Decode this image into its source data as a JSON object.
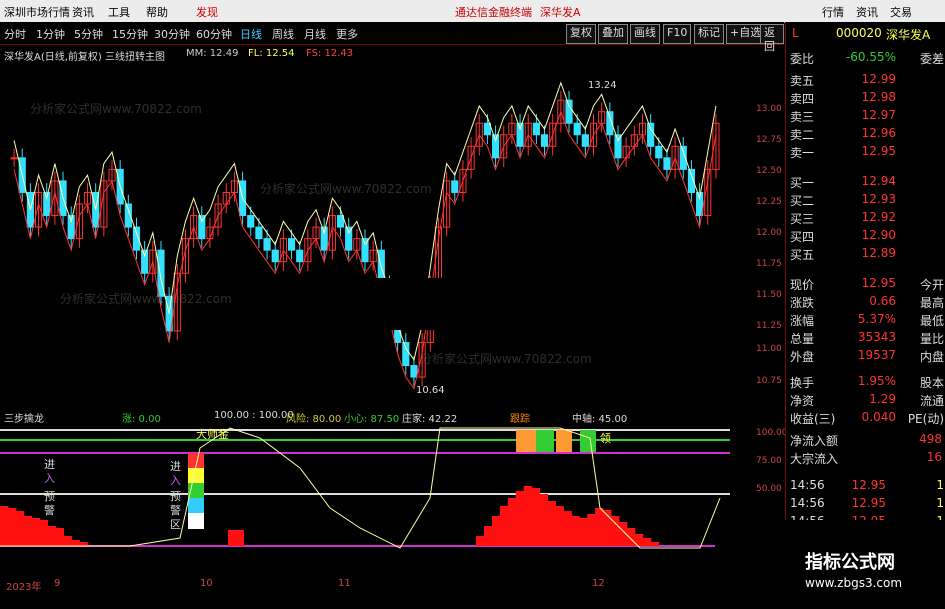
{
  "menu": [
    "深圳市场行情",
    "资讯",
    "工具",
    "帮助",
    "发现"
  ],
  "menu_center": [
    "通达信金融终端",
    "深华发A"
  ],
  "menu_right": [
    "行情",
    "资讯",
    "交易"
  ],
  "periods": [
    "分时",
    "1分钟",
    "5分钟",
    "15分钟",
    "30分钟",
    "60分钟",
    "日线",
    "周线",
    "月线",
    "更多"
  ],
  "toolbar_buttons": [
    "复权",
    "叠加",
    "画线",
    "F10",
    "标记",
    "+自选",
    "返回"
  ],
  "stock": {
    "name": "深华发A",
    "title": "深华发A(日线,前复权) 三线扭转主图",
    "code": "000020",
    "flag": "L"
  },
  "mm": "MM: 12.49",
  "fl": "FL: 12.54",
  "fs": "FS: 12.43",
  "price_high_label": "13.24",
  "price_low_label": "10.64",
  "axis_labels": [
    "13.00",
    "12.75",
    "12.50",
    "12.25",
    "12.00",
    "11.75",
    "11.50",
    "11.25",
    "11.00",
    "10.75"
  ],
  "sub_axis": [
    "100.00",
    "75.00",
    "50.00"
  ],
  "sub": {
    "name": "三步擒龙",
    "zhang": "涨: 0.00",
    "v100": "100.00 : 100.00",
    "fengxian": "风险: 80.00",
    "xiaoxin": "小心: 87.50",
    "zhuangjia": "庄家: 42.22",
    "genzong": "跟踪",
    "zhongzhou": "中轴: 45.00"
  },
  "sub_texts": {
    "jin": "进",
    "ru": "入",
    "yu": "预",
    "jing": "警",
    "da": "大",
    "qu": "区",
    "label_top": "大师金",
    "label_ling": "领"
  },
  "right": {
    "weibi_label": "委比",
    "weibi_val": "-60.55%",
    "weicha": "委差",
    "sell": [
      [
        "卖五",
        "12.99"
      ],
      [
        "卖四",
        "12.98"
      ],
      [
        "卖三",
        "12.97"
      ],
      [
        "卖二",
        "12.96"
      ],
      [
        "卖一",
        "12.95"
      ]
    ],
    "buy": [
      [
        "买一",
        "12.94"
      ],
      [
        "买二",
        "12.93"
      ],
      [
        "买三",
        "12.92"
      ],
      [
        "买四",
        "12.90"
      ],
      [
        "买五",
        "12.89"
      ]
    ],
    "quote": [
      [
        "现价",
        "12.95",
        "今开"
      ],
      [
        "涨跌",
        "0.66",
        "最高"
      ],
      [
        "涨幅",
        "5.37%",
        "最低"
      ],
      [
        "总量",
        "35343",
        "量比"
      ],
      [
        "外盘",
        "19537",
        "内盘"
      ]
    ],
    "quote2": [
      [
        "换手",
        "1.95%",
        "股本"
      ],
      [
        "净资",
        "1.29",
        "流通"
      ],
      [
        "收益(三)",
        "0.040",
        "PE(动)"
      ]
    ],
    "flow": [
      [
        "净流入额",
        "498"
      ],
      [
        "大宗流入",
        "16"
      ]
    ],
    "ticks": [
      [
        "14:56",
        "12.95",
        "1"
      ],
      [
        "14:56",
        "12.95",
        "1"
      ],
      [
        "14:56",
        "12.95",
        "1"
      ]
    ]
  },
  "ad": {
    "title": "指标公式网",
    "url": "www.zbgs3.com"
  },
  "dates": [
    "2023年",
    "9",
    "10",
    "11",
    "12"
  ],
  "watermark": "分析家公式网www.70822.com",
  "colors": {
    "up": "#ff3333",
    "down": "#33e0ff",
    "green": "#33cc33",
    "yellow": "#ffff55",
    "magenta": "#cc33cc"
  },
  "chart_data": {
    "type": "candlestick",
    "ylim": [
      10.64,
      13.24
    ],
    "closes": [
      12.6,
      12.3,
      12.0,
      12.3,
      12.1,
      12.4,
      12.1,
      11.9,
      12.2,
      12.3,
      12.0,
      12.4,
      12.5,
      12.2,
      12.0,
      11.8,
      11.6,
      11.8,
      11.4,
      11.1,
      11.6,
      11.9,
      12.1,
      11.9,
      12.0,
      12.2,
      12.3,
      12.4,
      12.1,
      12.0,
      11.9,
      11.8,
      11.7,
      11.9,
      11.8,
      11.7,
      11.9,
      12.0,
      11.8,
      12.1,
      12.0,
      11.8,
      11.9,
      11.7,
      11.8,
      11.5,
      11.3,
      11.0,
      10.8,
      10.7,
      11.0,
      11.5,
      12.0,
      12.4,
      12.3,
      12.5,
      12.7,
      12.9,
      12.8,
      12.6,
      12.8,
      12.9,
      12.7,
      12.9,
      12.8,
      12.7,
      12.9,
      13.1,
      12.9,
      12.8,
      12.7,
      12.9,
      13.0,
      12.8,
      12.6,
      12.7,
      12.8,
      12.9,
      12.7,
      12.6,
      12.5,
      12.7,
      12.5,
      12.3,
      12.1,
      12.5,
      12.9
    ]
  }
}
